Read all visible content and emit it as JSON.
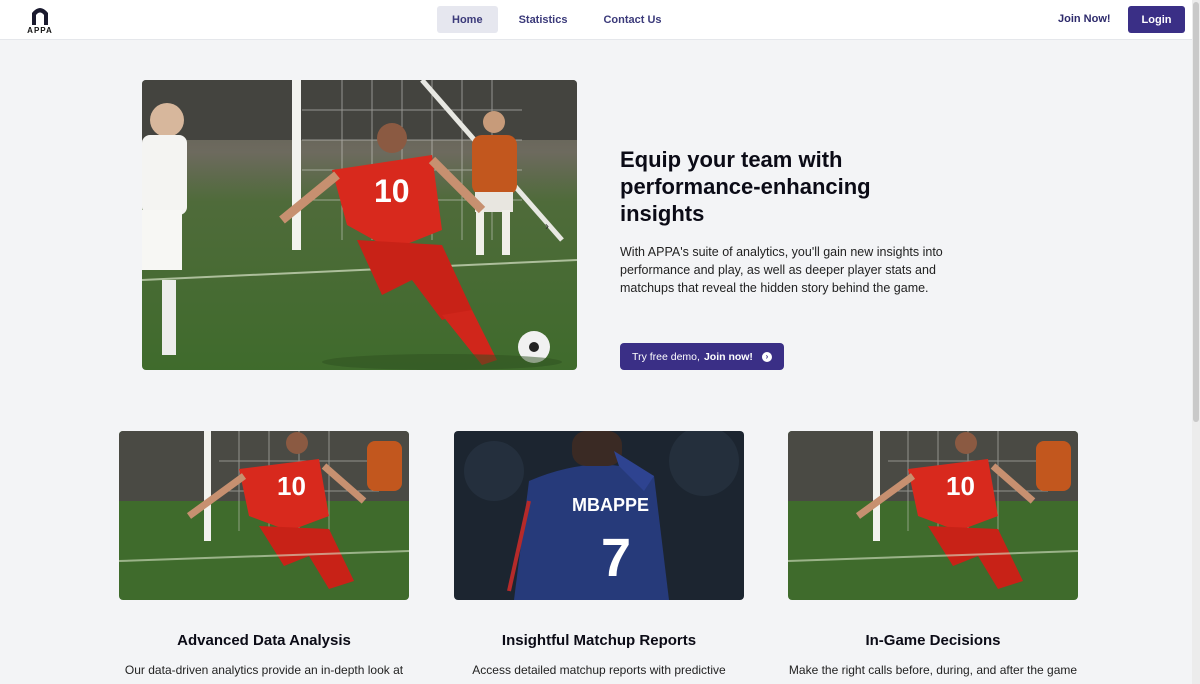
{
  "nav": {
    "logo_text": "APPA",
    "links": [
      {
        "label": "Home"
      },
      {
        "label": "Statistics"
      },
      {
        "label": "Contact Us"
      }
    ],
    "join_label": "Join Now!",
    "login_label": "Login"
  },
  "hero": {
    "title": "Equip your team with performance-enhancing insights",
    "description": "With APPA's suite of analytics, you'll gain new insights into performance and play, as well as deeper player stats and matchups that reveal the hidden story behind the game.",
    "cta_prefix": "Try free demo,",
    "cta_action": "Join now!",
    "jersey_number": "10"
  },
  "features": [
    {
      "title": "Advanced Data Analysis",
      "description": "Our data-driven analytics provide an in-depth look at",
      "jersey_number": "10"
    },
    {
      "title": "Insightful Matchup Reports",
      "description": "Access detailed matchup reports with predictive",
      "jersey_name": "MBAPPE",
      "jersey_number": "7"
    },
    {
      "title": "In-Game Decisions",
      "description": "Make the right calls before, during, and after the game",
      "jersey_number": "10"
    }
  ],
  "colors": {
    "brand": "#3a2f86",
    "nav_text": "#3b3a7a",
    "background": "#f3f4f6"
  }
}
